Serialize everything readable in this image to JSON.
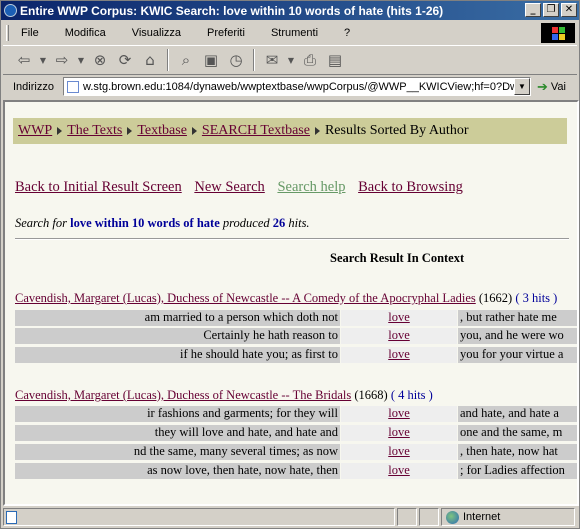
{
  "window": {
    "title": "Entire WWP Corpus: KWIC Search: love within 10 words of hate (hits 1-26)"
  },
  "menubar": [
    "File",
    "Modifica",
    "Visualizza",
    "Preferiti",
    "Strumenti",
    "?"
  ],
  "toolbar_icons": [
    "back-icon",
    "forward-icon",
    "stop-icon",
    "refresh-icon",
    "home-icon",
    "search-icon",
    "favorites-icon",
    "history-icon",
    "mail-icon",
    "print-icon",
    "edit-icon"
  ],
  "address": {
    "label": "Indirizzo",
    "url": "w.stg.brown.edu:1084/dynaweb/wwptextbase/wwpCorpus/@WWP__KWICView;hf=0?Dw",
    "go_label": "Vai"
  },
  "breadcrumb": {
    "items": [
      "WWP",
      "The Texts",
      "Textbase",
      "SEARCH Textbase"
    ],
    "current": "Results Sorted By Author"
  },
  "nav_links": {
    "back_initial": "Back to Initial Result Screen",
    "new_search": "New Search",
    "search_help": "Search help",
    "back_browsing": "Back to Browsing"
  },
  "search_summary": {
    "prefix": "Search for",
    "query": "love within 10 words of hate",
    "mid": "produced",
    "hits": "26",
    "suffix": "hits."
  },
  "context_heading": "Search Result In Context",
  "results": [
    {
      "title": "Cavendish, Margaret (Lucas), Duchess of Newcastle -- A Comedy of the Apocryphal Ladies",
      "year": "(1662)",
      "hits": "( 3 hits )",
      "rows": [
        {
          "left": "am married to a person which doth not",
          "keyword": "love",
          "right": ", but rather hate me"
        },
        {
          "left": "Certainly he hath reason to",
          "keyword": "love",
          "right": "you, and he were wo"
        },
        {
          "left": "if he should hate you; as first to",
          "keyword": "love",
          "right": "you for your virtue a"
        }
      ]
    },
    {
      "title": "Cavendish, Margaret (Lucas), Duchess of Newcastle -- The Bridals",
      "year": "(1668)",
      "hits": "( 4 hits )",
      "rows": [
        {
          "left": "ir fashions and garments; for they will",
          "keyword": "love",
          "right": "and hate, and hate a"
        },
        {
          "left": "they will love and hate, and hate and",
          "keyword": "love",
          "right": "one and the same, m"
        },
        {
          "left": "nd the same, many several times; as now",
          "keyword": "love",
          "right": ", then hate, now hat"
        },
        {
          "left": "as now love, then hate, now hate, then",
          "keyword": "love",
          "right": "; for Ladies affection"
        }
      ]
    }
  ],
  "statusbar": {
    "zone": "Internet"
  }
}
